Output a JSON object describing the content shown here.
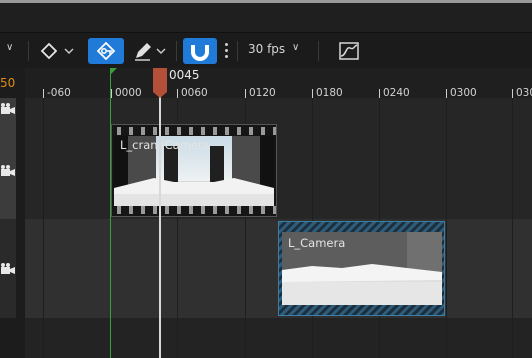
{
  "toolbar": {
    "fps_label": "30 fps"
  },
  "ruler": {
    "left_partial_label": "50",
    "ticks": [
      "-060",
      "0000",
      "0060",
      "0120",
      "0180",
      "0240",
      "0300",
      "030"
    ]
  },
  "playhead": {
    "frame_label": "0045"
  },
  "clips": [
    {
      "label": "L_craneCamera"
    },
    {
      "label": "L_Camera"
    }
  ],
  "colors": {
    "accent_blue": "#1f7ad8",
    "playhead": "#b4503a",
    "section_start": "#3aa03a",
    "selection_hatch": "#2e5c7a",
    "frame_orange": "#e08a1a"
  },
  "icons": [
    "key-icon",
    "pen-icon",
    "magnet-icon",
    "camera-icon",
    "curve-editor-icon",
    "diamond-key-icon"
  ]
}
